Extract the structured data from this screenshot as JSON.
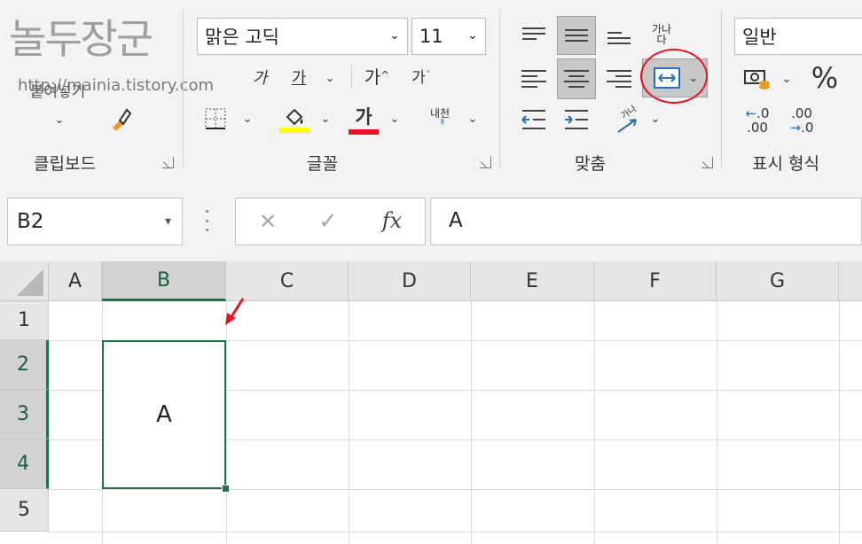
{
  "watermark": {
    "logo": "놀두장군",
    "url": "http://mainia.tistory.com"
  },
  "clipboard": {
    "paste_label": "붙여넣기",
    "group_label": "클립보드"
  },
  "font": {
    "name": "맑은 고딕",
    "size": "11",
    "italic_glyph": "가",
    "underline_glyph": "가",
    "grow_glyph": "가",
    "shrink_glyph": "가",
    "color_glyph": "가",
    "phonetic_glyph": "내천",
    "group_label": "글꼴",
    "fill_color": "#ffff00",
    "text_color": "#e81123"
  },
  "alignment": {
    "wrap_glyph": "가나",
    "wrap_glyph2": "다",
    "orient_glyph": "가나",
    "group_label": "맞춤",
    "highlight_color": "#e81123"
  },
  "number": {
    "format": "일반",
    "percent_glyph": "%",
    "inc_dec_top": ".0",
    "inc_dec_bottom": ".00",
    "dec_top": ".00",
    "dec_bottom": ".0",
    "group_label": "표시 형식"
  },
  "formula_bar": {
    "namebox": "B2",
    "cancel_glyph": "✕",
    "enter_glyph": "✓",
    "fx_glyph": "fx",
    "content": "A"
  },
  "sheet": {
    "columns": [
      "A",
      "B",
      "C",
      "D",
      "E",
      "F",
      "G"
    ],
    "rows": [
      "1",
      "2",
      "3",
      "4",
      "5"
    ],
    "merged_value": "A",
    "accent": "#217346"
  }
}
